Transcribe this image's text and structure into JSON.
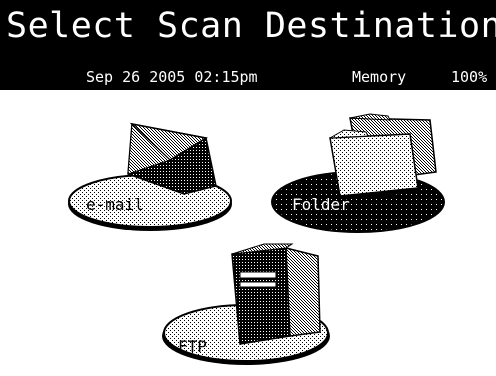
{
  "header": {
    "title": "Select Scan Destination"
  },
  "status": {
    "datetime": "Sep 26 2005 02:15pm",
    "memory_label": "Memory",
    "memory_value": "100%"
  },
  "destinations": [
    {
      "label": "e-mail",
      "icon": "envelope-icon",
      "selected": false
    },
    {
      "label": "Folder",
      "icon": "folder-icon",
      "selected": true
    },
    {
      "label": "FTP",
      "icon": "server-icon",
      "selected": false
    }
  ],
  "colors": {
    "background": "#ffffff",
    "bar": "#000000",
    "bar_text": "#ffffff",
    "platform_light": "#f2f2f2",
    "platform_selected": "#000000"
  }
}
